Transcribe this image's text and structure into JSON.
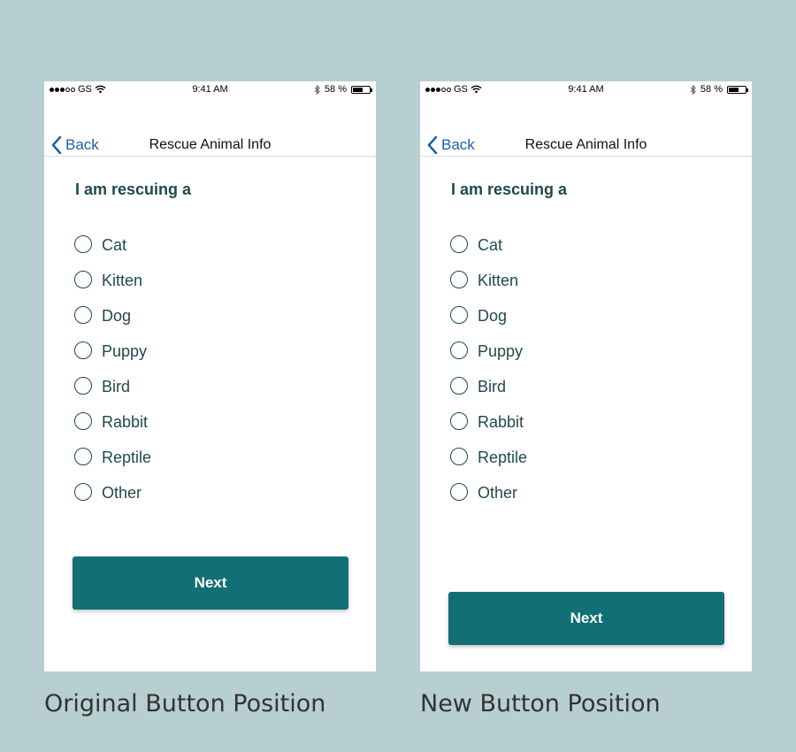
{
  "status_bar": {
    "carrier": "GS",
    "time": "9:41 AM",
    "battery_text": "58 %",
    "battery_level": 0.58
  },
  "nav": {
    "back_label": "Back",
    "title": "Rescue Animal Info"
  },
  "form": {
    "question": "I am rescuing a",
    "options": [
      "Cat",
      "Kitten",
      "Dog",
      "Puppy",
      "Bird",
      "Rabbit",
      "Reptile",
      "Other"
    ],
    "next_label": "Next"
  },
  "captions": {
    "left": "Original Button Position",
    "right": "New Button Position"
  },
  "colors": {
    "background": "#b7cfd1",
    "accent": "#116f75",
    "text": "#1f4a4d",
    "link": "#1e5fa8"
  }
}
